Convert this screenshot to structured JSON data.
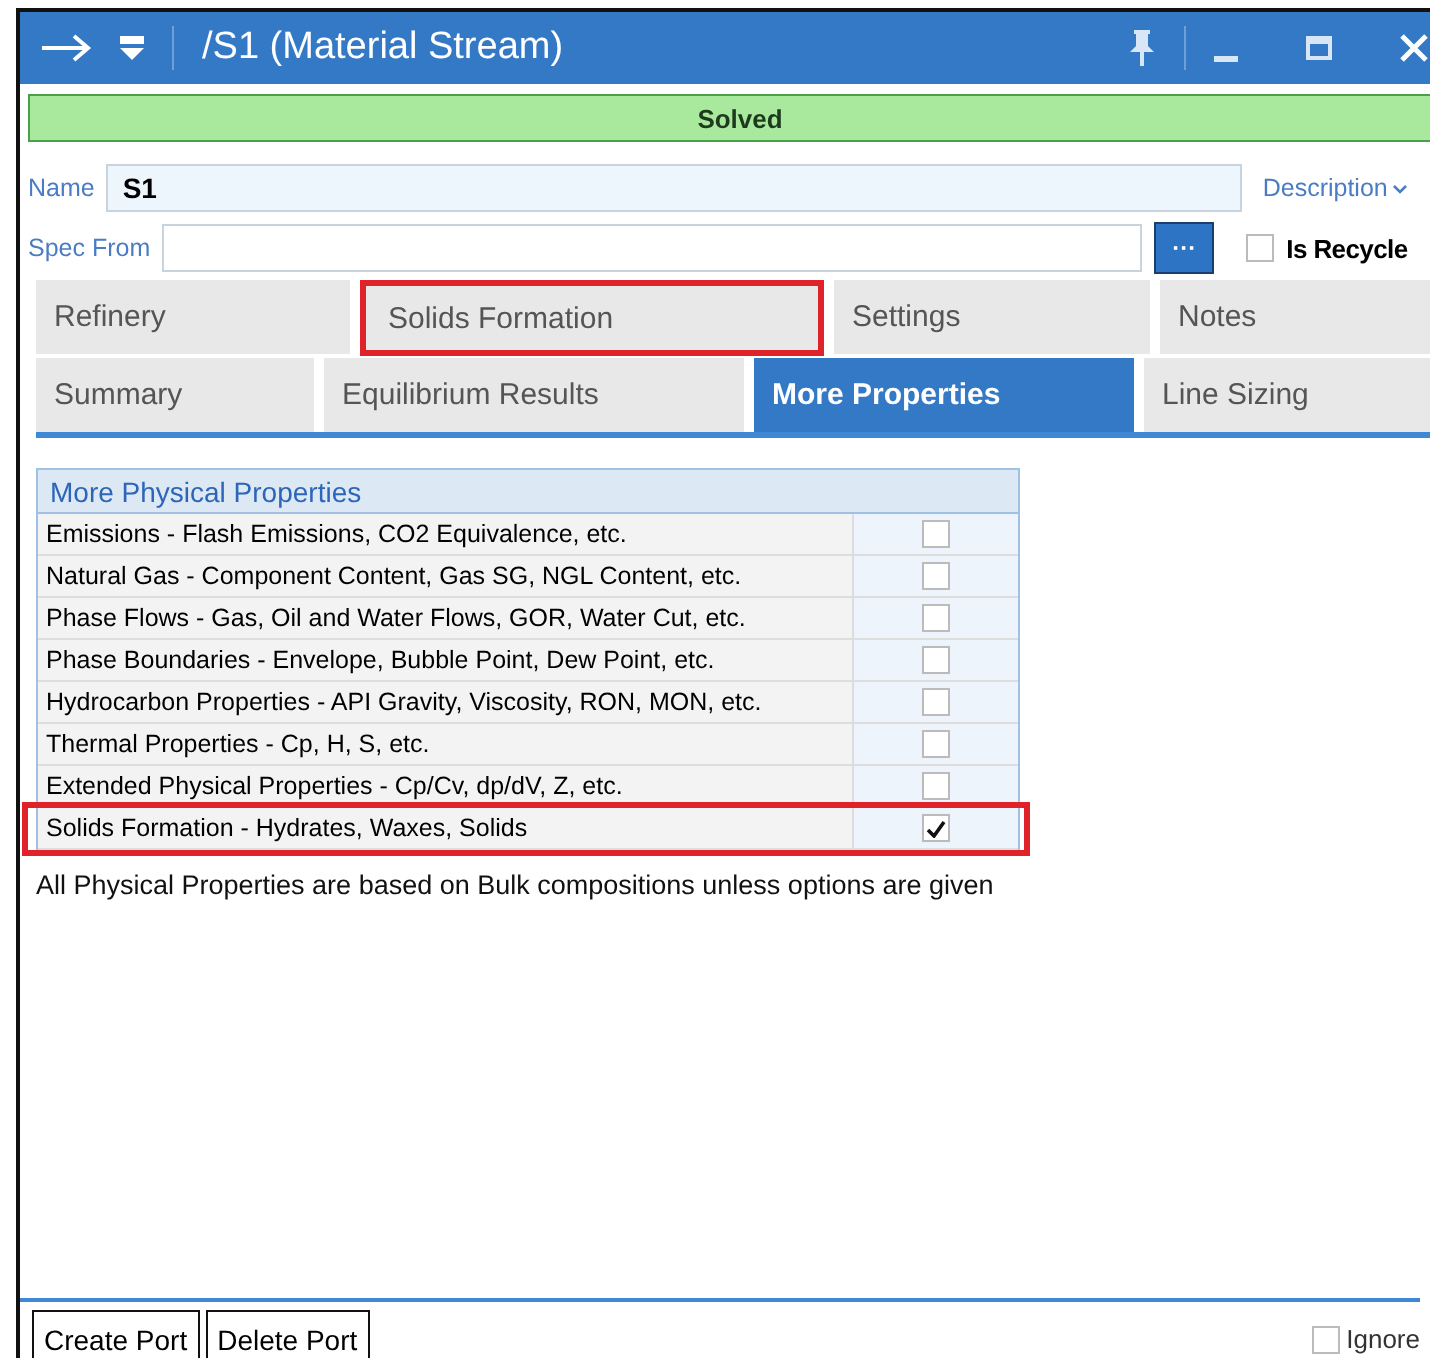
{
  "window": {
    "title": "/S1 (Material Stream)"
  },
  "status": "Solved",
  "name_field": {
    "label": "Name",
    "value": "S1",
    "description": "Description"
  },
  "spec_from": {
    "label": "Spec From",
    "button": "···",
    "recycle_label": "Is Recycle",
    "recycle_checked": false
  },
  "tab_rows": [
    [
      {
        "label": "Refinery",
        "selected": false,
        "highlighted": false
      },
      {
        "label": "Solids Formation",
        "selected": false,
        "highlighted": true
      },
      {
        "label": "Settings",
        "selected": false,
        "highlighted": false
      },
      {
        "label": "Notes",
        "selected": false,
        "highlighted": false
      }
    ],
    [
      {
        "label": "Summary",
        "selected": false,
        "highlighted": false
      },
      {
        "label": "Equilibrium Results",
        "selected": false,
        "highlighted": false
      },
      {
        "label": "More Properties",
        "selected": true,
        "highlighted": false
      },
      {
        "label": "Line Sizing",
        "selected": false,
        "highlighted": false
      }
    ]
  ],
  "properties": {
    "title": "More Physical Properties",
    "rows": [
      {
        "label": "Emissions - Flash Emissions, CO2 Equivalence, etc.",
        "checked": false,
        "highlighted": false
      },
      {
        "label": "Natural Gas - Component Content, Gas SG, NGL Content, etc.",
        "checked": false,
        "highlighted": false
      },
      {
        "label": "Phase Flows - Gas, Oil and Water Flows, GOR, Water Cut, etc.",
        "checked": false,
        "highlighted": false
      },
      {
        "label": "Phase Boundaries - Envelope, Bubble Point, Dew Point, etc.",
        "checked": false,
        "highlighted": false
      },
      {
        "label": "Hydrocarbon Properties - API Gravity, Viscosity, RON, MON, etc.",
        "checked": false,
        "highlighted": false
      },
      {
        "label": "Thermal Properties - Cp, H, S, etc.",
        "checked": false,
        "highlighted": false
      },
      {
        "label": "Extended Physical Properties - Cp/Cv, dp/dV, Z, etc.",
        "checked": false,
        "highlighted": false
      },
      {
        "label": "Solids Formation - Hydrates, Waxes, Solids",
        "checked": true,
        "highlighted": true
      }
    ]
  },
  "note": "All Physical Properties are based on Bulk compositions unless options are given",
  "footer": {
    "buttons": [
      "Create Port",
      "Delete Port"
    ],
    "ignored_label": "Ignore",
    "ignored_checked": false
  }
}
